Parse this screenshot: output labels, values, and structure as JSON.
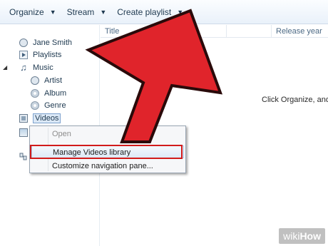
{
  "toolbar": {
    "organize": "Organize",
    "stream": "Stream",
    "create_playlist": "Create playlist"
  },
  "columns": {
    "title": "Title",
    "release_year": "Release year"
  },
  "nav": {
    "user": "Jane Smith",
    "playlists": "Playlists",
    "music": "Music",
    "artist": "Artist",
    "album": "Album",
    "genre": "Genre",
    "videos": "Videos"
  },
  "hint": "Click Organize, and",
  "context_menu": {
    "open": "Open",
    "manage": "Manage Videos library",
    "customize": "Customize navigation pane..."
  },
  "watermark": {
    "part1": "wiki",
    "part2": "How"
  },
  "colors": {
    "arrow": "#e0242b",
    "highlight_box": "#d11b1b",
    "selection": "#dbe8f6"
  },
  "icons": [
    "user-icon",
    "playlists-icon",
    "music-icon",
    "artist-icon",
    "album-icon",
    "genre-icon",
    "videos-icon",
    "pictures-icon",
    "network-icon",
    "chevron-down-icon"
  ]
}
